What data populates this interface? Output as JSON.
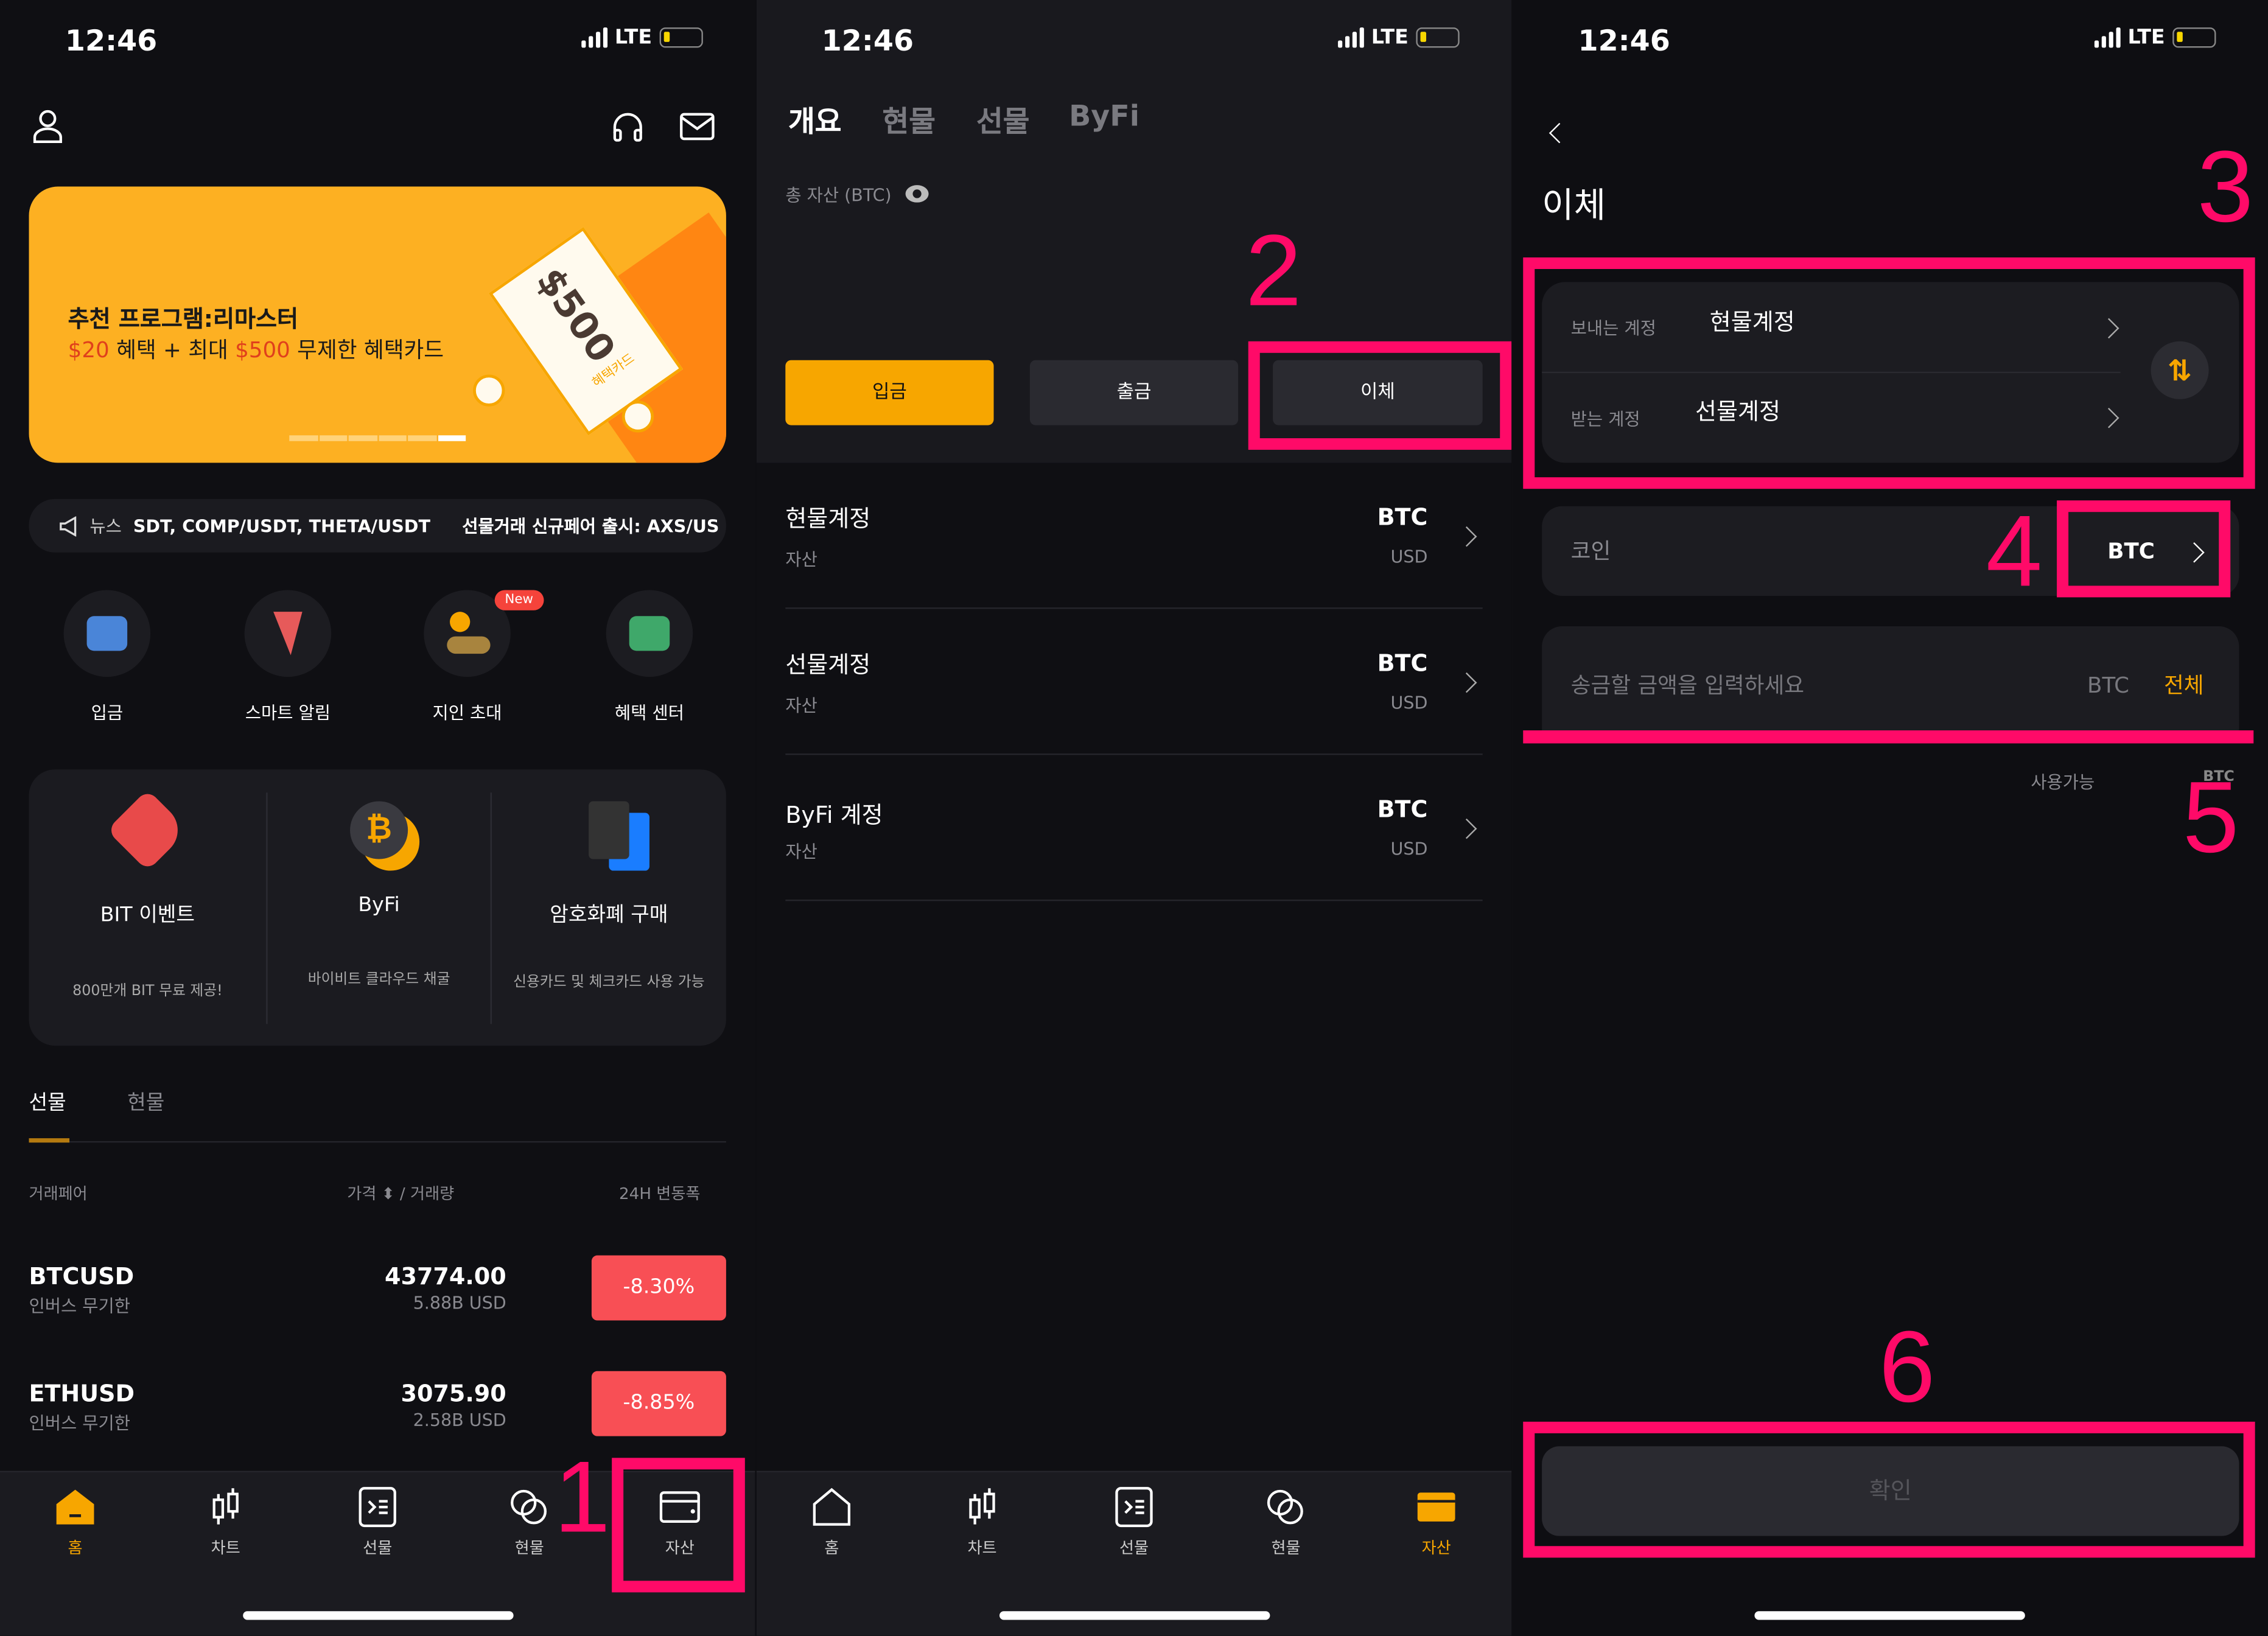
{
  "status": {
    "time": "12:46",
    "network": "LTE"
  },
  "colors": {
    "accent": "#f7a600",
    "annotation": "#ff0a68",
    "negative": "#f84f55",
    "banner": "#fdb022"
  },
  "home": {
    "icons": [
      "user-icon",
      "headset-icon",
      "mail-icon"
    ],
    "banner": {
      "title": "추천 프로그램:리마스터",
      "line_a": "$20",
      "line_b": " 혜택 + 최대 ",
      "line_c": "$500",
      "line_d": " 무제한 혜택카드",
      "ticket_amount": "$500",
      "ticket_label": "혜택카드"
    },
    "news": {
      "label": "뉴스",
      "text1": "SDT, COMP/USDT, THETA/USDT",
      "text2": "선물거래 신규페어 출시: AXS/US"
    },
    "shortcuts": [
      {
        "label": "입금",
        "icon": "wallet-icon"
      },
      {
        "label": "스마트 알림",
        "icon": "alert-icon"
      },
      {
        "label": "지인 초대",
        "icon": "invite-icon",
        "badge": "New"
      },
      {
        "label": "혜택 센터",
        "icon": "reward-icon"
      }
    ],
    "cards": [
      {
        "title": "BIT 이벤트",
        "subtitle": "800만개 BIT 무료 제공!"
      },
      {
        "title": "ByFi",
        "subtitle": "바이비트 클라우드 채굴"
      },
      {
        "title": "암호화폐 구매",
        "subtitle": "신용카드 및 체크카드 사용 가능"
      }
    ],
    "market_tabs": [
      "선물",
      "현물"
    ],
    "columns": [
      "거래페어",
      "가격 ⬍ / 거래량",
      "24H 변동폭"
    ],
    "rows": [
      {
        "pair": "BTCUSD",
        "type": "인버스 무기한",
        "price": "43774.00",
        "volume": "5.88B USD",
        "change": "-8.30%"
      },
      {
        "pair": "ETHUSD",
        "type": "인버스 무기한",
        "price": "3075.90",
        "volume": "2.58B USD",
        "change": "-8.85%"
      }
    ]
  },
  "nav": [
    "홈",
    "차트",
    "선물",
    "현물",
    "자산"
  ],
  "assets": {
    "tabs": [
      "개요",
      "현물",
      "선물",
      "ByFi"
    ],
    "total_label": "총 자산 (BTC)",
    "buttons": [
      "입금",
      "출금",
      "이체"
    ],
    "accounts": [
      {
        "name": "현물계정",
        "sub": "자산",
        "coin": "BTC",
        "fiat": "USD"
      },
      {
        "name": "선물계정",
        "sub": "자산",
        "coin": "BTC",
        "fiat": "USD"
      },
      {
        "name": "ByFi 계정",
        "sub": "자산",
        "coin": "BTC",
        "fiat": "USD"
      }
    ]
  },
  "transfer": {
    "title": "이체",
    "from_label": "보내는 계정",
    "from_value": "현물계정",
    "to_label": "받는 계정",
    "to_value": "선물계정",
    "coin_label": "코인",
    "coin_value": "BTC",
    "amount_placeholder": "송금할 금액을 입력하세요",
    "amount_unit": "BTC",
    "all_label": "전체",
    "available_label": "사용가능",
    "available_unit": "BTC",
    "confirm": "확인"
  },
  "annotations": [
    "1",
    "2",
    "3",
    "4",
    "5",
    "6"
  ]
}
